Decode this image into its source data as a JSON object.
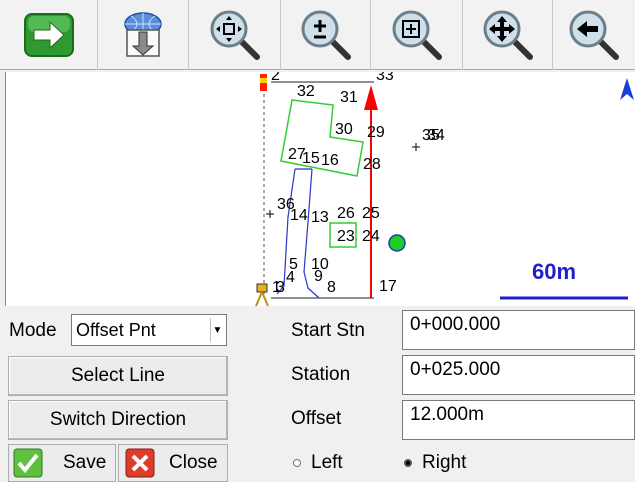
{
  "toolbar": {
    "buttons": [
      {
        "icon": "forward-arrow-icon"
      },
      {
        "icon": "download-globe-icon"
      },
      {
        "icon": "zoom-extents-icon"
      },
      {
        "icon": "zoom-in-out-icon"
      },
      {
        "icon": "zoom-window-icon"
      },
      {
        "icon": "pan-icon"
      },
      {
        "icon": "zoom-previous-icon"
      }
    ]
  },
  "map": {
    "scale_label": "60m",
    "point_labels": [
      "2",
      "33",
      "32",
      "31",
      "30",
      "29",
      "35",
      "34",
      "27",
      "15",
      "16",
      "28",
      "36",
      "14",
      "13",
      "26",
      "25",
      "23",
      "24",
      "5",
      "10",
      "1",
      "3",
      "4",
      "9",
      "8",
      "17"
    ],
    "colors": {
      "centerline": "#ff0000",
      "parcels": "#33cc33",
      "scale_bar": "#1f1fcc",
      "current_position": "#22cc22",
      "north_arrow": "#1a3fd6"
    }
  },
  "form": {
    "mode_label": "Mode",
    "mode_value": "Offset Pnt",
    "select_line": "Select Line",
    "switch_direction": "Switch Direction",
    "save": "Save",
    "close": "Close",
    "start_stn_label": "Start Stn",
    "start_stn_value": "0+000.000",
    "station_label": "Station",
    "station_value": "0+025.000",
    "offset_label": "Offset",
    "offset_value": "12.000m",
    "left_label": "Left",
    "right_label": "Right",
    "side_selected": "Right"
  }
}
